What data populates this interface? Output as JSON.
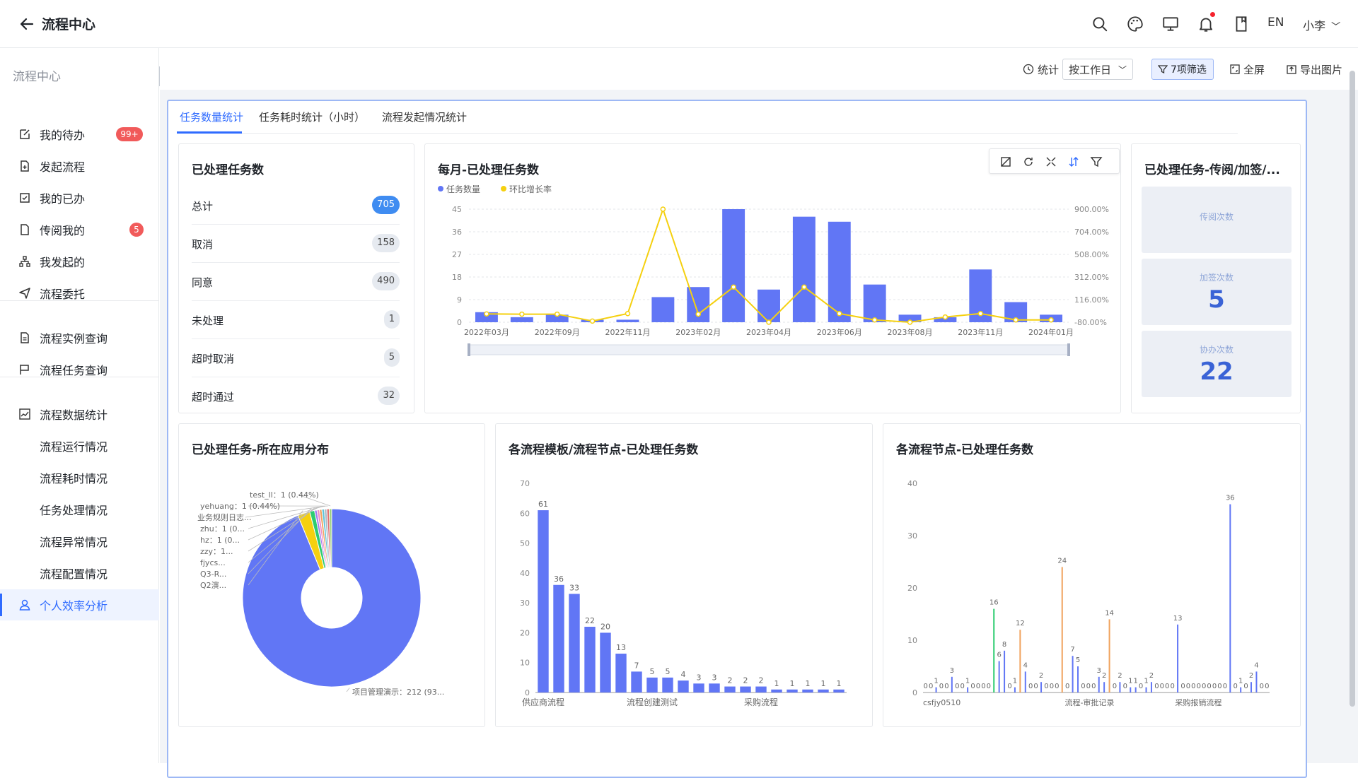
{
  "header": {
    "title": "流程中心",
    "lang": "EN",
    "user": "小李"
  },
  "sidebar": {
    "title": "流程中心",
    "items": [
      {
        "label": "我的待办",
        "badge": "99+"
      },
      {
        "label": "发起流程"
      },
      {
        "label": "我的已办"
      },
      {
        "label": "传阅我的",
        "badge": "5"
      },
      {
        "label": "我发起的"
      },
      {
        "label": "流程委托"
      },
      {
        "label": "流程实例查询"
      },
      {
        "label": "流程任务查询"
      },
      {
        "label": "流程数据统计"
      },
      {
        "label": "流程运行情况"
      },
      {
        "label": "流程耗时情况"
      },
      {
        "label": "任务处理情况"
      },
      {
        "label": "流程异常情况"
      },
      {
        "label": "流程配置情况"
      },
      {
        "label": "个人效率分析"
      }
    ]
  },
  "toolbar": {
    "stat_label": "统计",
    "period": "按工作日",
    "filter": "7项筛选",
    "fullscreen": "全屏",
    "export": "导出图片"
  },
  "tabs": [
    {
      "label": "任务数量统计",
      "active": true
    },
    {
      "label": "任务耗时统计（小时）"
    },
    {
      "label": "流程发起情况统计"
    }
  ],
  "summary": {
    "title": "已处理任务数",
    "rows": [
      {
        "label": "总计",
        "count": "705"
      },
      {
        "label": "取消",
        "count": "158"
      },
      {
        "label": "同意",
        "count": "490"
      },
      {
        "label": "未处理",
        "count": "1"
      },
      {
        "label": "超时取消",
        "count": "5"
      },
      {
        "label": "超时通过",
        "count": "32"
      }
    ]
  },
  "tiles": {
    "title": "已处理任务-传阅/加签/...",
    "items": [
      {
        "label": "传阅次数",
        "value": ""
      },
      {
        "label": "加签次数",
        "value": "5"
      },
      {
        "label": "协办次数",
        "value": "22"
      }
    ]
  },
  "chart_data": [
    {
      "type": "bar",
      "title": "每月-已处理任务数",
      "legend": [
        "任务数量",
        "环比增长率"
      ],
      "x_tick_labels": [
        "2022年03月",
        "2022年09月",
        "2022年11月",
        "2023年02月",
        "2023年04月",
        "2023年06月",
        "2023年08月",
        "2023年11月",
        "2024年01月"
      ],
      "left_axis": {
        "ticks": [
          0,
          9,
          18,
          27,
          36,
          45
        ],
        "ylim": [
          0,
          45
        ]
      },
      "right_axis": {
        "tick_labels": [
          "-80.00%",
          "116.00%",
          "312.00%",
          "508.00%",
          "704.00%",
          "900.00%"
        ],
        "ylim": [
          -80,
          900
        ]
      },
      "series": [
        {
          "name": "任务数量",
          "type": "bar",
          "color": "#6176f5",
          "values": [
            4,
            2,
            3,
            1,
            1,
            10,
            14,
            45,
            13,
            42,
            40,
            15,
            3,
            2,
            21,
            8,
            3
          ]
        },
        {
          "name": "环比增长率",
          "type": "line",
          "color": "#f5d00f",
          "values": [
            -8,
            -10,
            -10,
            -70,
            -5,
            900,
            -10,
            225,
            -80,
            225,
            -5,
            -60,
            -80,
            -35,
            -5,
            -60,
            -60
          ]
        }
      ]
    },
    {
      "type": "pie",
      "title": "已处理任务-所在应用分布",
      "slices": [
        {
          "label": "项目管理演示：212 (93...",
          "value": 212,
          "color": "#6176f5"
        },
        {
          "label": "Q2演...",
          "value": 5,
          "color": "#f5d00f"
        },
        {
          "label": "Q3-R...",
          "value": 2,
          "color": "#2ecc71"
        },
        {
          "label": "fjycs...",
          "value": 1,
          "color": "#a37cf0"
        },
        {
          "label": "zzy：1...",
          "value": 1,
          "color": "#f38ec3"
        },
        {
          "label": "hz：1 (0...",
          "value": 1,
          "color": "#f0a35e"
        },
        {
          "label": "zhu：1 (0...",
          "value": 1,
          "color": "#5ec4d8"
        },
        {
          "label": "业务规则日志...",
          "value": 1,
          "color": "#b0b7c3"
        },
        {
          "label": "yehuang：1 (0.44%)",
          "value": 1,
          "color": "#e07070"
        },
        {
          "label": "test_ll：1 (0.44%)",
          "value": 1,
          "color": "#9ad07a"
        }
      ]
    },
    {
      "type": "bar",
      "title": "各流程模板/流程节点-已处理任务数",
      "x_tick_labels": [
        "供应商流程",
        "流程创建测试",
        "采购流程"
      ],
      "ylim": [
        0,
        70
      ],
      "y_ticks": [
        0,
        10,
        20,
        30,
        40,
        50,
        60,
        70
      ],
      "values": [
        61,
        36,
        33,
        22,
        20,
        13,
        7,
        5,
        5,
        4,
        3,
        3,
        2,
        2,
        2,
        1,
        1,
        1,
        1,
        1
      ]
    },
    {
      "type": "bar",
      "title": "各流程节点-已处理任务数",
      "x_tick_labels": [
        "csfjy0510",
        "流程-审批记录",
        "采购报销流程"
      ],
      "ylim": [
        0,
        40
      ],
      "y_ticks": [
        0,
        10,
        20,
        30,
        40
      ],
      "bars": [
        {
          "value": 0,
          "color": "#6176f5"
        },
        {
          "value": 0,
          "color": "#6176f5"
        },
        {
          "value": 1,
          "color": "#6176f5"
        },
        {
          "value": 0,
          "color": "#6176f5"
        },
        {
          "value": 0,
          "color": "#6176f5"
        },
        {
          "value": 3,
          "color": "#6176f5"
        },
        {
          "value": 0,
          "color": "#6176f5"
        },
        {
          "value": 0,
          "color": "#6176f5"
        },
        {
          "value": 1,
          "color": "#6176f5"
        },
        {
          "value": 0,
          "color": "#6176f5"
        },
        {
          "value": 0,
          "color": "#6176f5"
        },
        {
          "value": 0,
          "color": "#6176f5"
        },
        {
          "value": 0,
          "color": "#6176f5"
        },
        {
          "value": 16,
          "color": "#2ecc71"
        },
        {
          "value": 6,
          "color": "#6176f5"
        },
        {
          "value": 8,
          "color": "#6176f5"
        },
        {
          "value": 0,
          "color": "#6176f5"
        },
        {
          "value": 1,
          "color": "#6176f5"
        },
        {
          "value": 12,
          "color": "#f0a35e"
        },
        {
          "value": 4,
          "color": "#6176f5"
        },
        {
          "value": 0,
          "color": "#6176f5"
        },
        {
          "value": 0,
          "color": "#6176f5"
        },
        {
          "value": 2,
          "color": "#6176f5"
        },
        {
          "value": 0,
          "color": "#6176f5"
        },
        {
          "value": 0,
          "color": "#6176f5"
        },
        {
          "value": 0,
          "color": "#6176f5"
        },
        {
          "value": 24,
          "color": "#f0a35e"
        },
        {
          "value": 0,
          "color": "#6176f5"
        },
        {
          "value": 7,
          "color": "#6176f5"
        },
        {
          "value": 5,
          "color": "#6176f5"
        },
        {
          "value": 0,
          "color": "#6176f5"
        },
        {
          "value": 0,
          "color": "#6176f5"
        },
        {
          "value": 0,
          "color": "#6176f5"
        },
        {
          "value": 3,
          "color": "#6176f5"
        },
        {
          "value": 2,
          "color": "#6176f5"
        },
        {
          "value": 14,
          "color": "#f0a35e"
        },
        {
          "value": 0,
          "color": "#6176f5"
        },
        {
          "value": 2,
          "color": "#6176f5"
        },
        {
          "value": 0,
          "color": "#6176f5"
        },
        {
          "value": 1,
          "color": "#6176f5"
        },
        {
          "value": 1,
          "color": "#6176f5"
        },
        {
          "value": 0,
          "color": "#6176f5"
        },
        {
          "value": 1,
          "color": "#6176f5"
        },
        {
          "value": 2,
          "color": "#6176f5"
        },
        {
          "value": 0,
          "color": "#6176f5"
        },
        {
          "value": 0,
          "color": "#6176f5"
        },
        {
          "value": 0,
          "color": "#6176f5"
        },
        {
          "value": 0,
          "color": "#6176f5"
        },
        {
          "value": 13,
          "color": "#6176f5"
        },
        {
          "value": 0,
          "color": "#6176f5"
        },
        {
          "value": 0,
          "color": "#6176f5"
        },
        {
          "value": 0,
          "color": "#6176f5"
        },
        {
          "value": 0,
          "color": "#6176f5"
        },
        {
          "value": 0,
          "color": "#6176f5"
        },
        {
          "value": 0,
          "color": "#6176f5"
        },
        {
          "value": 0,
          "color": "#6176f5"
        },
        {
          "value": 0,
          "color": "#6176f5"
        },
        {
          "value": 0,
          "color": "#6176f5"
        },
        {
          "value": 36,
          "color": "#6176f5"
        },
        {
          "value": 0,
          "color": "#6176f5"
        },
        {
          "value": 1,
          "color": "#6176f5"
        },
        {
          "value": 0,
          "color": "#6176f5"
        },
        {
          "value": 2,
          "color": "#6176f5"
        },
        {
          "value": 4,
          "color": "#6176f5"
        },
        {
          "value": 0,
          "color": "#6176f5"
        },
        {
          "value": 0,
          "color": "#6176f5"
        }
      ]
    }
  ]
}
